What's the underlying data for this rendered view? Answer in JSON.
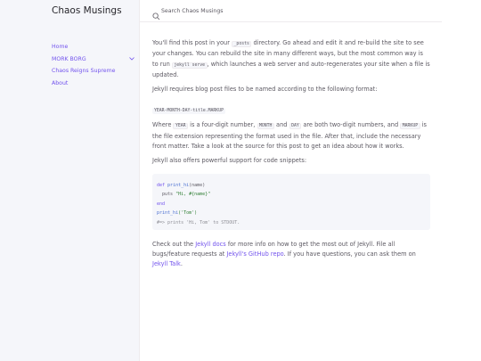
{
  "site": {
    "title": "Chaos Musings"
  },
  "search": {
    "placeholder": "Search Chaos Musings"
  },
  "nav": {
    "items": [
      {
        "label": "Home"
      },
      {
        "label": "MORK BORG",
        "expand_icon": "chevron-down-icon"
      },
      {
        "label": "Chaos Reigns Supreme"
      },
      {
        "label": "About"
      }
    ]
  },
  "content": {
    "p1": {
      "t1": "You'll find this post in your ",
      "c1": "_posts",
      "t2": " directory. Go ahead and edit it and re-build the site to see your changes. You can rebuild the site in many different ways, but the most common way is to run ",
      "c2": "jekyll serve",
      "t3": ", which launches a web server and auto-regenerates your site when a file is updated."
    },
    "p2": "Jekyll requires blog post files to be named according to the following format:",
    "format": "YEAR-MONTH-DAY-title.MARKUP",
    "p3": {
      "t1": "Where ",
      "c1": "YEAR",
      "t2": " is a four-digit number, ",
      "c2": "MONTH",
      "t3": " and ",
      "c3": "DAY",
      "t4": " are both two-digit numbers, and ",
      "c4": "MARKUP",
      "t5": " is the file extension representing the format used in the file. After that, include the necessary front matter. Take a look at the source for this post to get an idea about how it works."
    },
    "p4": "Jekyll also offers powerful support for code snippets:",
    "code": {
      "l1_kw": "def",
      "l1_fn": "print_hi",
      "l1_arg": "(name)",
      "l2_a": "  puts ",
      "l2_str": "\"Hi, #{name}\"",
      "l3": "end",
      "l4_fn": "print_hi",
      "l4_str": "('Tom')",
      "l5": "#=> prints 'Hi, Tom' to STDOUT."
    },
    "p5": {
      "t1": "Check out the ",
      "link1": "Jekyll docs",
      "t2": " for more info on how to get the most out of Jekyll. File all bugs/feature requests at ",
      "link2": "Jekyll's GitHub repo",
      "t3": ". If you have questions, you can ask them on ",
      "link3": "Jekyll Talk",
      "t4": "."
    }
  }
}
